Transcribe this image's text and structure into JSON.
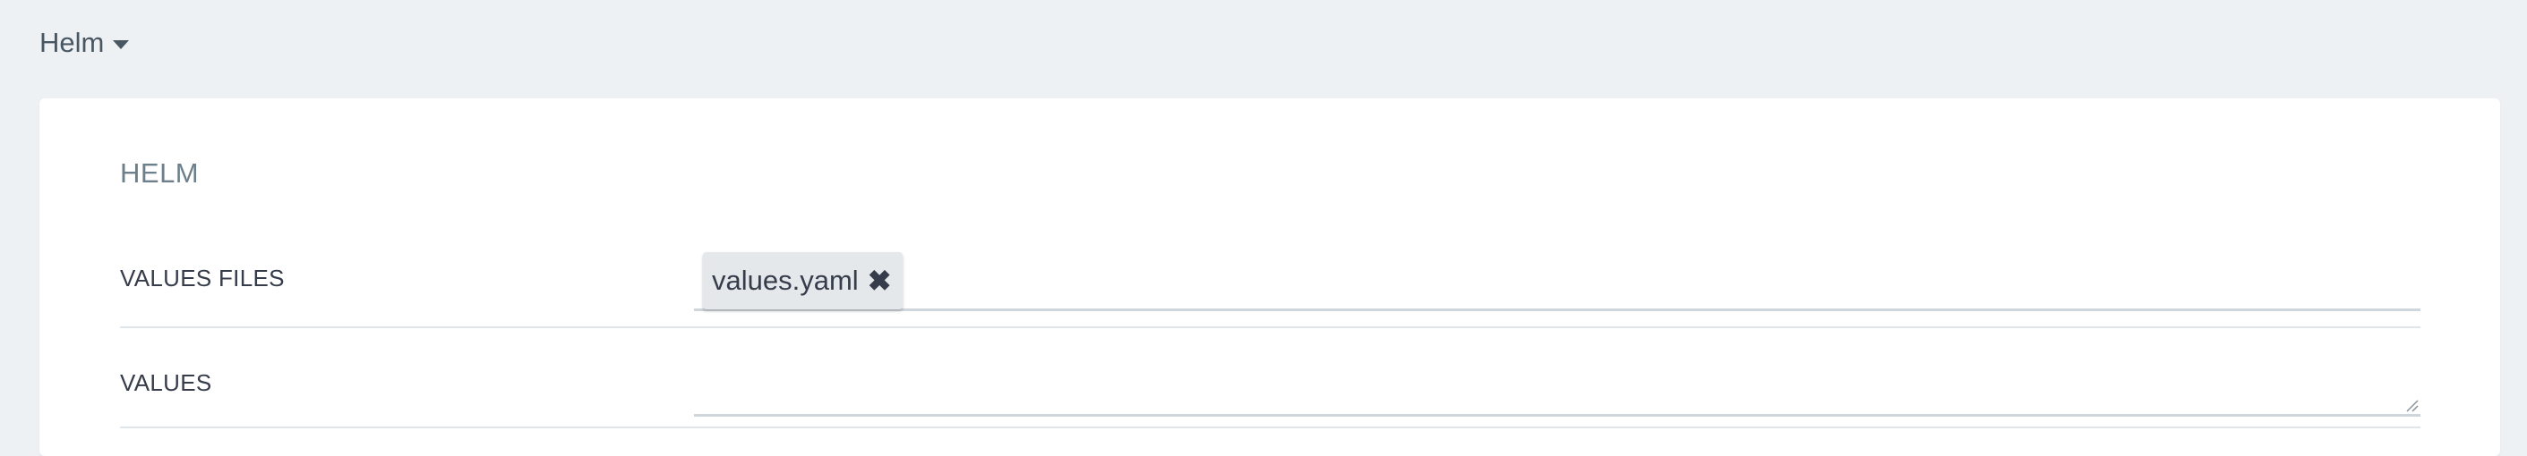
{
  "section": {
    "label": "Helm"
  },
  "card": {
    "title": "HELM",
    "values_files": {
      "label": "VALUES FILES",
      "tags": [
        {
          "label": "values.yaml",
          "remove_icon": "close-icon"
        }
      ]
    },
    "values": {
      "label": "VALUES",
      "value": ""
    }
  }
}
